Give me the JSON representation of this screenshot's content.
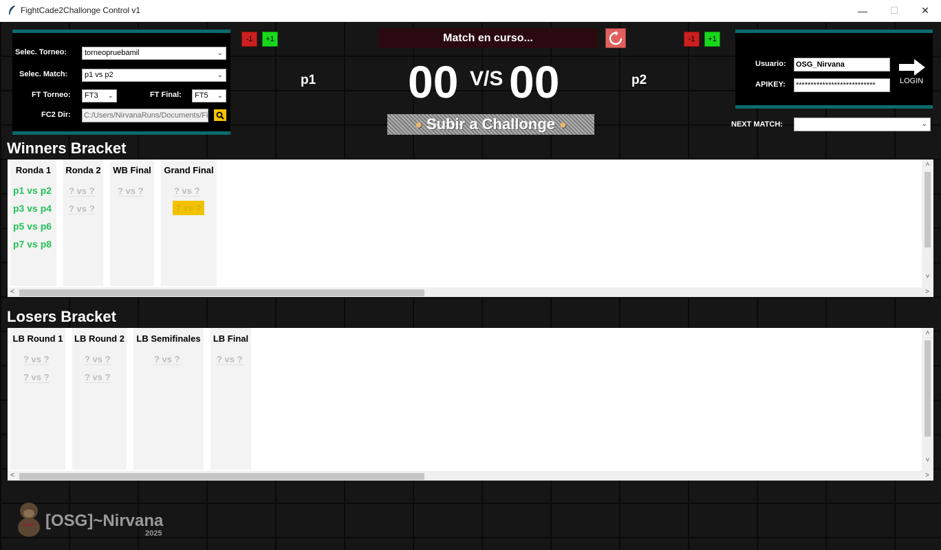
{
  "window": {
    "title": "FightCade2Challonge Control v1",
    "min": "—",
    "max": "☐",
    "close": "✕"
  },
  "controls": {
    "torneo_label": "Selec. Torneo:",
    "torneo_value": "torneopruebamil",
    "match_label": "Selec. Match:",
    "match_value": "p1 vs p2",
    "ft_torneo_label": "FT Torneo:",
    "ft_torneo_value": "FT3",
    "ft_final_label": "FT Final:",
    "ft_final_value": "FT5",
    "dir_label": "FC2 Dir:",
    "dir_value": "C:/Users/NirvanaRuns/Documents/Fig"
  },
  "score": {
    "status": "Match en curso...",
    "player1": "p1",
    "player2": "p2",
    "score1": "00",
    "score2": "00",
    "vs": "V/S",
    "minus": "-1",
    "plus": "+1",
    "upload": "Subir a Challonge"
  },
  "login": {
    "user_label": "Usuario:",
    "user_value": "OSG_Nirvana",
    "apikey_label": "APIKEY:",
    "apikey_value": "***************************",
    "button": "LOGIN"
  },
  "next_match": {
    "label": "NEXT MATCH:",
    "value": ""
  },
  "winners": {
    "title": "Winners Bracket",
    "columns": [
      {
        "header": "Ronda 1",
        "matches": [
          "p1 vs p2",
          "p3 vs p4",
          "p5 vs p6",
          "p7 vs p8"
        ]
      },
      {
        "header": "Ronda 2",
        "matches": [
          "? vs ?",
          "? vs ?"
        ]
      },
      {
        "header": "WB Final",
        "matches": [
          "? vs ?"
        ]
      },
      {
        "header": "Grand Final",
        "matches": [
          "? vs ?",
          "? vs ?"
        ]
      }
    ]
  },
  "losers": {
    "title": "Losers Bracket",
    "columns": [
      {
        "header": "LB Round 1",
        "matches": [
          "? vs ?",
          "? vs ?"
        ]
      },
      {
        "header": "LB Round 2",
        "matches": [
          "? vs ?",
          "? vs ?"
        ]
      },
      {
        "header": "LB Semifinales",
        "matches": [
          "? vs ?"
        ]
      },
      {
        "header": "LB Final",
        "matches": [
          "? vs ?"
        ]
      }
    ]
  },
  "brand": {
    "name": "[OSG]~Nirvana",
    "year": "2025"
  },
  "colors": {
    "accent": "#0b6b6e",
    "active_match": "#25c25a",
    "highlight": "#f2c200",
    "minus": "#cc1f1f",
    "plus": "#18d81c"
  },
  "icons": [
    "feather-icon",
    "search-icon",
    "reset-icon",
    "login-arrow-icon",
    "chevron-down-icon",
    "fireball-icon"
  ]
}
